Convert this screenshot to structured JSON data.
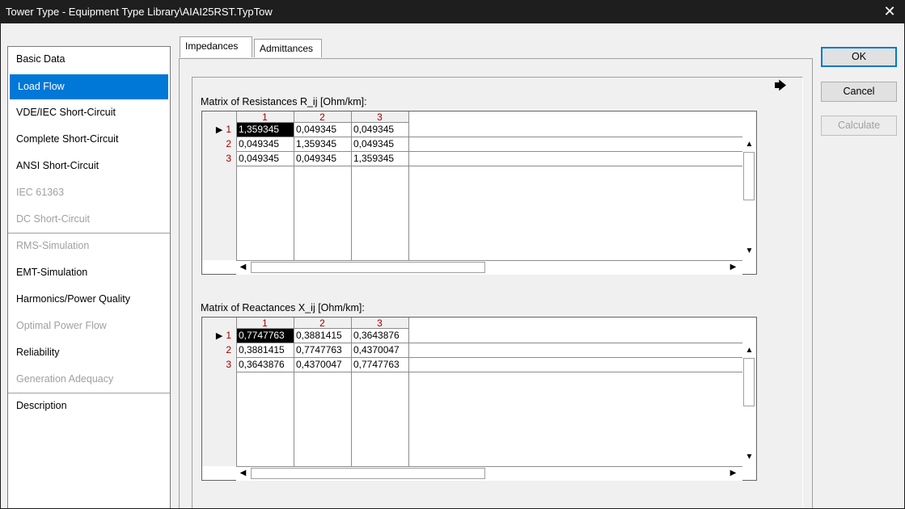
{
  "window": {
    "title": "Tower Type - Equipment Type Library\\AIAI25RST.TypTow",
    "close_glyph": "✕"
  },
  "sidebar": {
    "items": [
      {
        "label": "Basic Data",
        "state": "normal"
      },
      {
        "label": "Load Flow",
        "state": "selected"
      },
      {
        "label": "VDE/IEC Short-Circuit",
        "state": "normal"
      },
      {
        "label": "Complete Short-Circuit",
        "state": "normal"
      },
      {
        "label": "ANSI Short-Circuit",
        "state": "normal"
      },
      {
        "label": "IEC 61363",
        "state": "disabled"
      },
      {
        "label": "DC Short-Circuit",
        "state": "disabled"
      },
      {
        "label": "RMS-Simulation",
        "state": "disabled"
      },
      {
        "label": "EMT-Simulation",
        "state": "normal"
      },
      {
        "label": "Harmonics/Power Quality",
        "state": "normal"
      },
      {
        "label": "Optimal Power Flow",
        "state": "disabled"
      },
      {
        "label": "Reliability",
        "state": "normal"
      },
      {
        "label": "Generation Adequacy",
        "state": "disabled"
      },
      {
        "label": "Description",
        "state": "normal"
      }
    ]
  },
  "tabs": [
    {
      "label": "Impedances",
      "active": true
    },
    {
      "label": "Admittances",
      "active": false
    }
  ],
  "arrow_icon": "arrow-right-icon",
  "arrow_glyph": "🡆",
  "buttons": {
    "ok": "OK",
    "cancel": "Cancel",
    "calculate": "Calculate"
  },
  "resistance": {
    "label": "Matrix of Resistances R_ij [Ohm/km]:",
    "columns": [
      "1",
      "2",
      "3"
    ],
    "rows": [
      {
        "header": "1",
        "cells": [
          "1,359345",
          "0,049345",
          "0,049345"
        ]
      },
      {
        "header": "2",
        "cells": [
          "0,049345",
          "1,359345",
          "0,049345"
        ]
      },
      {
        "header": "3",
        "cells": [
          "0,049345",
          "0,049345",
          "1,359345"
        ]
      }
    ]
  },
  "reactance": {
    "label": "Matrix of Reactances X_ij [Ohm/km]:",
    "columns": [
      "1",
      "2",
      "3"
    ],
    "rows": [
      {
        "header": "1",
        "cells": [
          "0,7747763",
          "0,3881415",
          "0,3643876"
        ]
      },
      {
        "header": "2",
        "cells": [
          "0,3881415",
          "0,7747763",
          "0,4370047"
        ]
      },
      {
        "header": "3",
        "cells": [
          "0,3643876",
          "0,4370047",
          "0,7747763"
        ]
      }
    ]
  },
  "current_row_marker": "▶",
  "colors": {
    "selection": "#0078d7",
    "header_text": "#a00000",
    "titlebar": "#1e1e1e"
  }
}
